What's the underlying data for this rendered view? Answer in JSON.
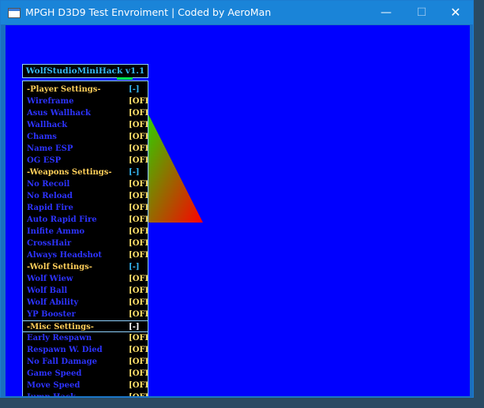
{
  "window": {
    "title": "MPGH D3D9 Test Envroiment | Coded by AeroMan",
    "minimize": "—",
    "maximize": "☐",
    "close": "✕"
  },
  "colors": {
    "client_background": "#0000ff",
    "menu_background": "#000000",
    "category_text": "#ffcf5a",
    "item_text": "#2d33ff",
    "off_text": "#ffe16b",
    "title_text": "#35b6f2",
    "triangle_gradient": [
      "#2fd000",
      "#ff0000"
    ]
  },
  "menu": {
    "title": "WolfStudioMiniHack v1.1",
    "rows": [
      {
        "label": "-Player Settings-",
        "value": "[-]",
        "kind": "cat"
      },
      {
        "label": "Wireframe",
        "value": "[OFF]",
        "kind": "item"
      },
      {
        "label": "Asus Wallhack",
        "value": "[OFF]",
        "kind": "item"
      },
      {
        "label": "Wallhack",
        "value": "[OFF]",
        "kind": "item"
      },
      {
        "label": "Chams",
        "value": "[OFF]",
        "kind": "item"
      },
      {
        "label": "Name ESP",
        "value": "[OFF]",
        "kind": "item"
      },
      {
        "label": "OG ESP",
        "value": "[OFF]",
        "kind": "item"
      },
      {
        "label": "-Weapons Settings-",
        "value": "[-]",
        "kind": "cat"
      },
      {
        "label": "No Recoil",
        "value": "[OFF]",
        "kind": "item"
      },
      {
        "label": "No Reload",
        "value": "[OFF]",
        "kind": "item"
      },
      {
        "label": "Rapid Fire",
        "value": "[OFF]",
        "kind": "item"
      },
      {
        "label": "Auto Rapid Fire",
        "value": "[OFF]",
        "kind": "item"
      },
      {
        "label": "Inifite Ammo",
        "value": "[OFF]",
        "kind": "item"
      },
      {
        "label": "CrossHair",
        "value": "[OFF]",
        "kind": "item"
      },
      {
        "label": "Always Headshot",
        "value": "[OFF]",
        "kind": "item"
      },
      {
        "label": "-Wolf Settings-",
        "value": "[-]",
        "kind": "cat"
      },
      {
        "label": "Wolf Wiew",
        "value": "[OFF]",
        "kind": "item"
      },
      {
        "label": "Wolf Ball",
        "value": "[OFF]",
        "kind": "item"
      },
      {
        "label": "Wolf Ability",
        "value": "[OFF]",
        "kind": "item"
      },
      {
        "label": "YP Booster",
        "value": "[OFF]",
        "kind": "item"
      },
      {
        "label": "-Misc Settings-",
        "value": "[-]",
        "kind": "cat",
        "selected": true
      },
      {
        "label": "Early Respawn",
        "value": "[OFF]",
        "kind": "item"
      },
      {
        "label": "Respawn W. Died",
        "value": "[OFF]",
        "kind": "item"
      },
      {
        "label": "No Fall Damage",
        "value": "[OFF]",
        "kind": "item"
      },
      {
        "label": "Game Speed",
        "value": "[OFF]",
        "kind": "item"
      },
      {
        "label": "Move Speed",
        "value": "[OFF]",
        "kind": "item"
      },
      {
        "label": "Jump Hack",
        "value": "[OFF]",
        "kind": "item"
      }
    ]
  }
}
